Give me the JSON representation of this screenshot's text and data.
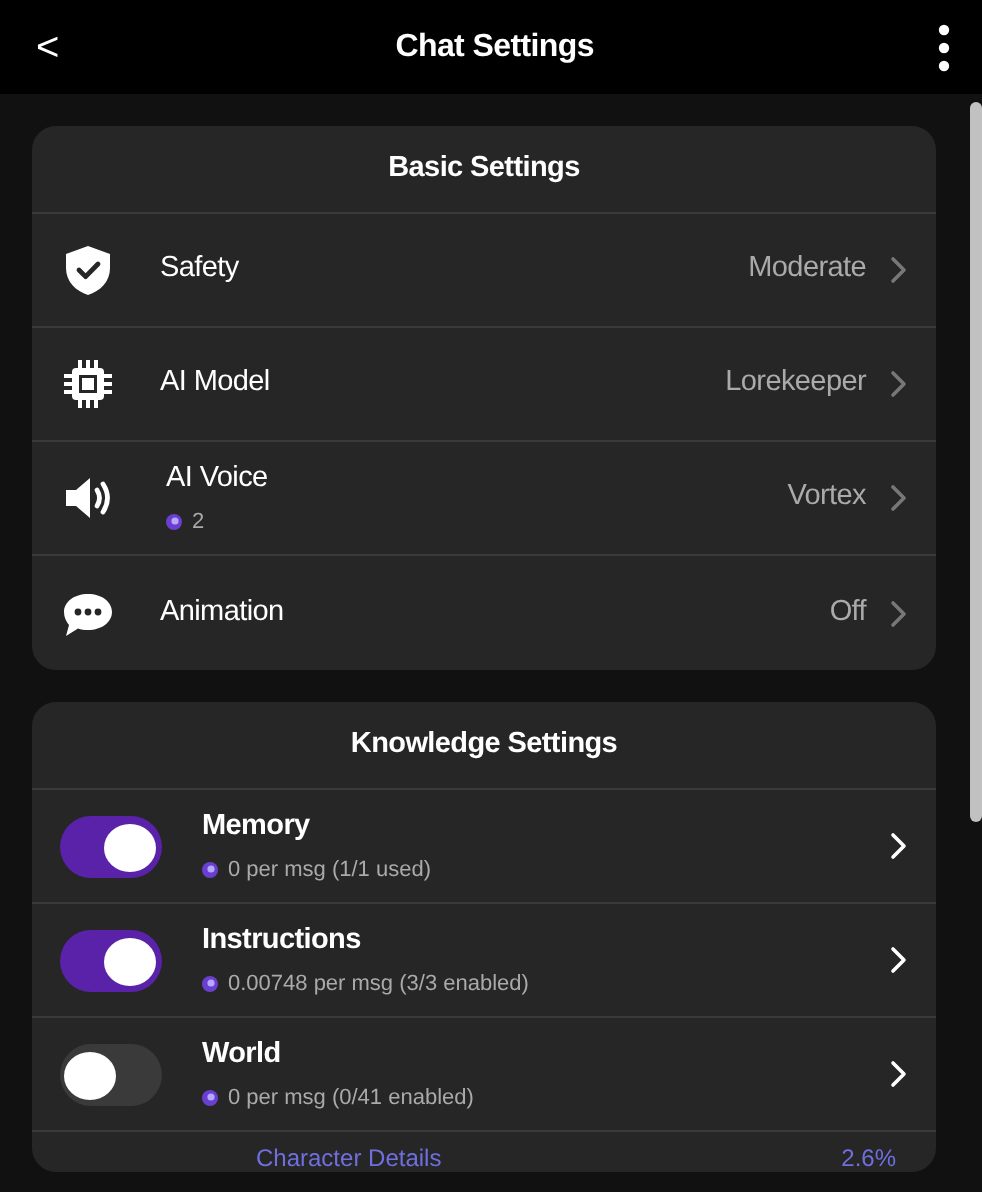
{
  "header": {
    "back": "<",
    "title": "Chat Settings"
  },
  "basic_settings": {
    "title": "Basic Settings",
    "items": [
      {
        "label": "Safety",
        "value": "Moderate"
      },
      {
        "label": "AI Model",
        "value": "Lorekeeper"
      },
      {
        "label": "AI Voice",
        "cost": "2",
        "value": "Vortex"
      },
      {
        "label": "Animation",
        "value": "Off"
      }
    ]
  },
  "knowledge_settings": {
    "title": "Knowledge Settings",
    "items": [
      {
        "label": "Memory",
        "cost": "0 per msg (1/1 used)",
        "on": true
      },
      {
        "label": "Instructions",
        "cost": "0.00748 per msg (3/3 enabled)",
        "on": true
      },
      {
        "label": "World",
        "cost": "0 per msg (0/41 enabled)",
        "on": false
      }
    ],
    "footer": {
      "link": "Character Details",
      "value": "2.6%"
    }
  }
}
